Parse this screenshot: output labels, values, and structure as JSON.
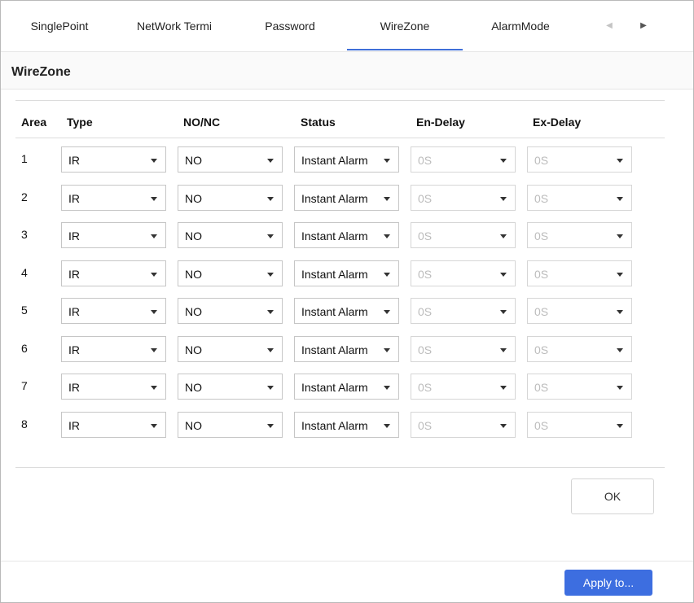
{
  "tabs": [
    {
      "label": "SinglePoint"
    },
    {
      "label": "NetWork Termi"
    },
    {
      "label": "Password"
    },
    {
      "label": "WireZone"
    },
    {
      "label": "AlarmMode"
    }
  ],
  "active_tab": "WireZone",
  "tab_scroll": {
    "left_icon": "chevron-left-icon",
    "right_icon": "chevron-right-icon"
  },
  "section": {
    "title": "WireZone"
  },
  "table": {
    "headers": {
      "area": "Area",
      "type": "Type",
      "nonc": "NO/NC",
      "status": "Status",
      "en_delay": "En-Delay",
      "ex_delay": "Ex-Delay"
    },
    "rows": [
      {
        "area": "1",
        "type": "IR",
        "nonc": "NO",
        "status": "Instant Alarm",
        "en_delay": "0S",
        "ex_delay": "0S"
      },
      {
        "area": "2",
        "type": "IR",
        "nonc": "NO",
        "status": "Instant Alarm",
        "en_delay": "0S",
        "ex_delay": "0S"
      },
      {
        "area": "3",
        "type": "IR",
        "nonc": "NO",
        "status": "Instant Alarm",
        "en_delay": "0S",
        "ex_delay": "0S"
      },
      {
        "area": "4",
        "type": "IR",
        "nonc": "NO",
        "status": "Instant Alarm",
        "en_delay": "0S",
        "ex_delay": "0S"
      },
      {
        "area": "5",
        "type": "IR",
        "nonc": "NO",
        "status": "Instant Alarm",
        "en_delay": "0S",
        "ex_delay": "0S"
      },
      {
        "area": "6",
        "type": "IR",
        "nonc": "NO",
        "status": "Instant Alarm",
        "en_delay": "0S",
        "ex_delay": "0S"
      },
      {
        "area": "7",
        "type": "IR",
        "nonc": "NO",
        "status": "Instant Alarm",
        "en_delay": "0S",
        "ex_delay": "0S"
      },
      {
        "area": "8",
        "type": "IR",
        "nonc": "NO",
        "status": "Instant Alarm",
        "en_delay": "0S",
        "ex_delay": "0S"
      }
    ]
  },
  "buttons": {
    "ok": "OK",
    "apply": "Apply to..."
  },
  "colors": {
    "accent": "#3d6ee0",
    "tab_underline": "#3f6fd8",
    "disabled_text": "#bcbcbc"
  }
}
